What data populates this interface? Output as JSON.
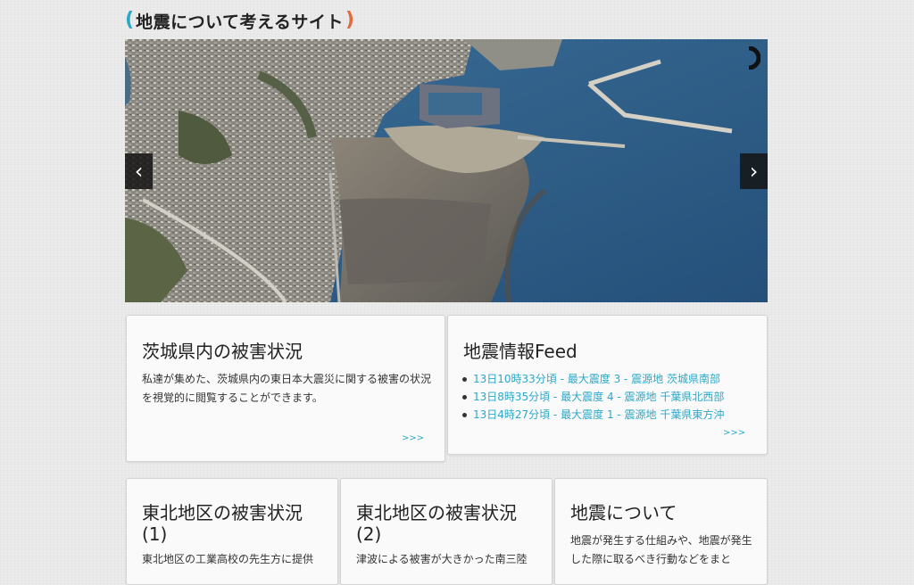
{
  "site": {
    "title": "地震について考えるサイト",
    "paren_left": "(",
    "paren_right": ")"
  },
  "slider": {
    "prev_icon": "‹",
    "next_icon": "›"
  },
  "cards": {
    "damage_ibaraki": {
      "title": "茨城県内の被害状況",
      "body": "私達が集めた、茨城県内の東日本大震災に関する被害の状況を視覚的に閲覧することができます。",
      "more": ">>>"
    },
    "feed": {
      "title": "地震情報Feed",
      "items": [
        "13日10時33分頃 - 最大震度 3 - 震源地 茨城県南部",
        "13日8時35分頃 - 最大震度 4 - 震源地 千葉県北西部",
        "13日4時27分頃 - 最大震度 1 - 震源地 千葉県東方沖"
      ],
      "more": ">>>"
    },
    "tohoku1": {
      "title": "東北地区の被害状況(1)",
      "body": "東北地区の工業高校の先生方に提供"
    },
    "tohoku2": {
      "title": "東北地区の被害状況(2)",
      "body": "津波による被害が大きかった南三陸"
    },
    "about": {
      "title": "地震について",
      "body": "地震が発生する仕組みや、地震が発生した際に取るべき行動などをまと"
    }
  }
}
